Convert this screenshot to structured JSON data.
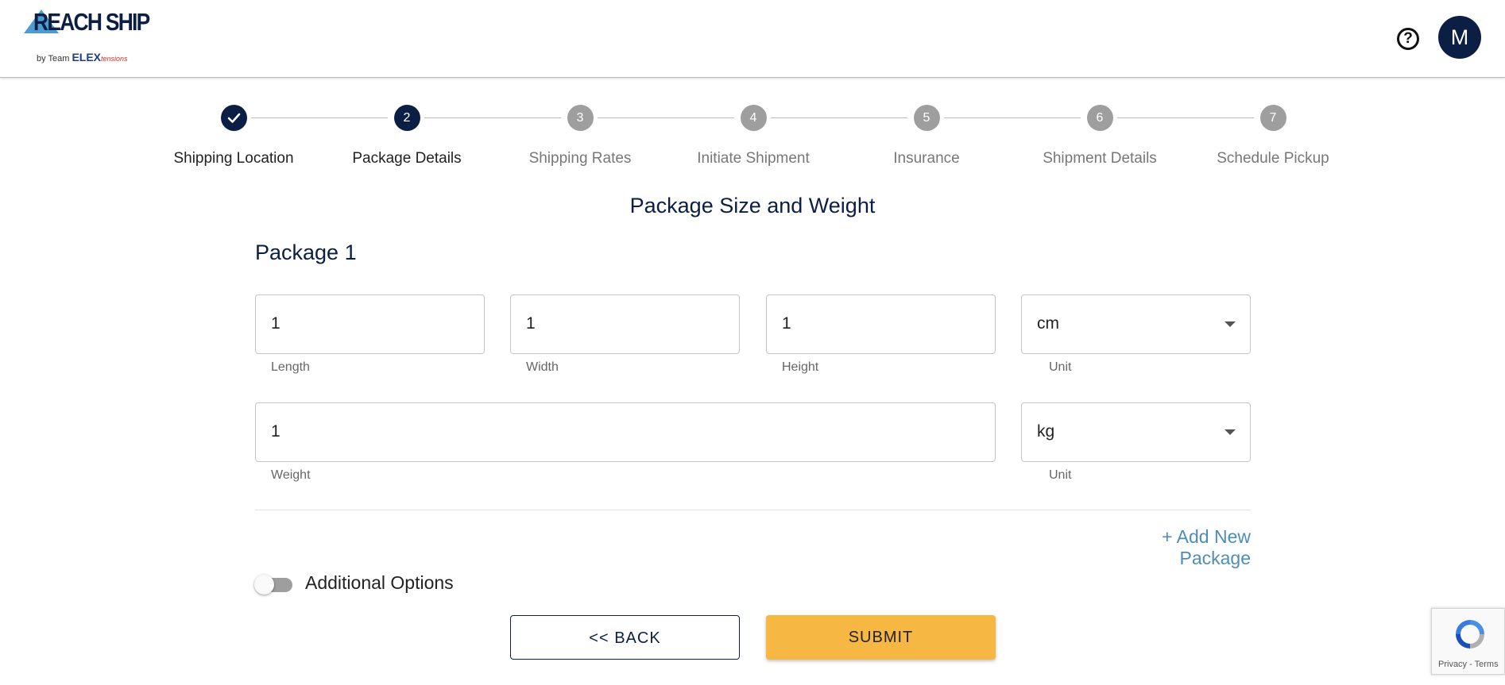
{
  "header": {
    "logo_text": "REACH SHIP",
    "logo_sub_prefix": "by Team",
    "logo_sub_brand": "ELEX",
    "logo_sub_ext": "tensions",
    "help_icon": "help-circle-icon",
    "avatar_initial": "M"
  },
  "stepper": {
    "steps": [
      {
        "number": "1",
        "label": "Shipping Location",
        "state": "done"
      },
      {
        "number": "2",
        "label": "Package Details",
        "state": "active"
      },
      {
        "number": "3",
        "label": "Shipping Rates",
        "state": "pending"
      },
      {
        "number": "4",
        "label": "Initiate Shipment",
        "state": "pending"
      },
      {
        "number": "5",
        "label": "Insurance",
        "state": "pending"
      },
      {
        "number": "6",
        "label": "Shipment Details",
        "state": "pending"
      },
      {
        "number": "7",
        "label": "Schedule Pickup",
        "state": "pending"
      }
    ]
  },
  "form": {
    "title": "Package Size and Weight",
    "package_title": "Package 1",
    "length": {
      "value": "1",
      "label": "Length"
    },
    "width": {
      "value": "1",
      "label": "Width"
    },
    "height": {
      "value": "1",
      "label": "Height"
    },
    "dim_unit": {
      "value": "cm",
      "label": "Unit"
    },
    "weight": {
      "value": "1",
      "label": "Weight"
    },
    "weight_unit": {
      "value": "kg",
      "label": "Unit"
    },
    "add_package_label": "+ Add New Package",
    "additional_options_label": "Additional Options",
    "additional_options_on": false,
    "back_label": "<< BACK",
    "submit_label": "SUBMIT"
  },
  "recaptcha": {
    "text": "Privacy - Terms"
  },
  "colors": {
    "primary": "#0b1f44",
    "accent": "#f7b743",
    "link": "#4e8db8"
  }
}
